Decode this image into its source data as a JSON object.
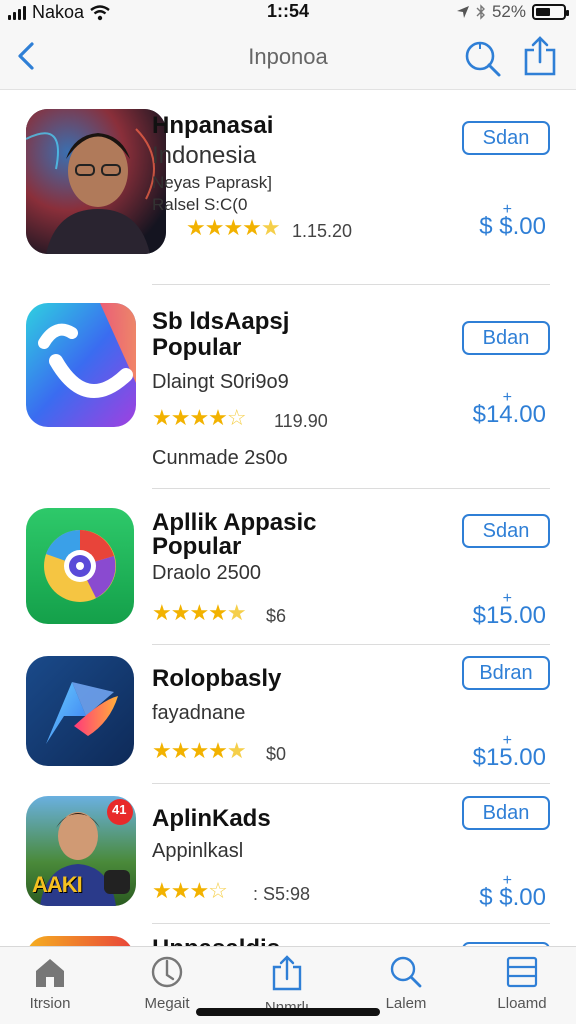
{
  "status_bar": {
    "carrier": "Nakoa",
    "time": "1::54",
    "battery_text": "52%",
    "battery_level": 0.52
  },
  "nav": {
    "title": "Inponoa"
  },
  "apps": [
    {
      "name_line1": "Hnpanasai",
      "name_line2": "Indonesia",
      "line3": "Neyas Paprask]",
      "line4": "Ralsel S:C(0",
      "stars": 4.5,
      "rating_text": "1.15.20",
      "button": "Sdan",
      "price": "$ $.00",
      "price_plus": "+"
    },
    {
      "name_line1": "Sb ldsAapsj",
      "name_line2": "Popular",
      "line3": "Dlaingt S0ri9o9",
      "stars": 4.5,
      "rating_text": "119.90",
      "line4": "Cunmade 2s0o",
      "button": "Bdan",
      "price": "$14.00",
      "price_plus": "+"
    },
    {
      "name_line1": "Apllik Appasic",
      "name_line2": "Popular",
      "line3": "Draolo 2500",
      "stars": 4.5,
      "rating_text": "$6",
      "button": "Sdan",
      "price": "$15.00",
      "price_plus": "+"
    },
    {
      "name_line1": "Rolopbasly",
      "line3": "fayadnane",
      "stars": 4.5,
      "rating_text": "$0",
      "button": "Bdran",
      "price": "$15.00",
      "price_plus": "+"
    },
    {
      "name_line1": "AplinKads",
      "line3": "Appinlkasl",
      "stars": 3.5,
      "rating_text": " : S5:98",
      "button": "Bdan",
      "price": "$ $.00",
      "price_plus": "+",
      "icon_text": "AAKI",
      "badge_text": "41"
    },
    {
      "name_line1": "Hnpasaldis"
    }
  ],
  "tabs": [
    {
      "label": "Itrsion",
      "icon": "home-icon"
    },
    {
      "label": "Megait",
      "icon": "compass-icon"
    },
    {
      "label": "Nnmrlı",
      "icon": "share-icon"
    },
    {
      "label": "Lalem",
      "icon": "search-icon"
    },
    {
      "label": "Lloamd",
      "icon": "list-icon"
    }
  ],
  "colors": {
    "accent": "#2f7fd6",
    "star": "#f2b200"
  }
}
